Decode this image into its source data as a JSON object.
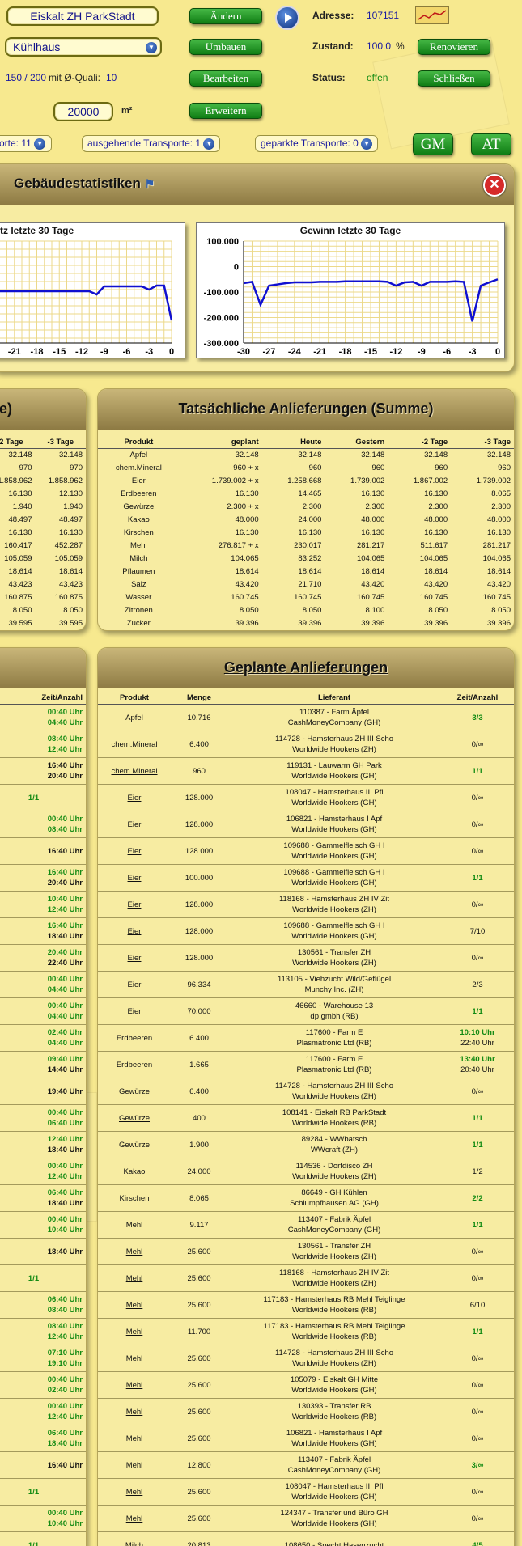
{
  "top": {
    "building_name": "Eiskalt ZH ParkStadt",
    "building_type": "Kühlhaus",
    "quali_prefix": "150 / 200",
    "quali_mid": " mit Ø-Quali:",
    "quali_value": "10",
    "area_value": "20000",
    "area_unit": "m²",
    "btn_aendern": "Ändern",
    "btn_umbauen": "Umbauen",
    "btn_bearbeiten": "Bearbeiten",
    "btn_erweitern": "Erweitern",
    "adresse_label": "Adresse:",
    "adresse_value": "107151",
    "zustand_label": "Zustand:",
    "zustand_value": "100.0",
    "zustand_unit": "%",
    "status_label": "Status:",
    "status_value": "offen",
    "btn_renovieren": "Renovieren",
    "btn_schliessen": "Schließen",
    "filter_left": "orte: 11",
    "filter_out": "ausgehende Transporte: 1",
    "filter_parked": "geparkte Transporte: 0",
    "btn_gm": "GM",
    "btn_at": "AT"
  },
  "stats": {
    "title": "Gebäudestatistiken"
  },
  "chart_data": [
    {
      "type": "line",
      "title": "tz letzte 30 Tage",
      "x": [
        -21,
        -18,
        -15,
        -12,
        -9,
        -6,
        -3,
        0
      ],
      "xlabel": "",
      "ylabel": ""
    },
    {
      "type": "line",
      "title": "Gewinn letzte 30 Tage",
      "x": [
        -30,
        -29,
        -28,
        -27,
        -26,
        -25,
        -24,
        -23,
        -22,
        -21,
        -20,
        -19,
        -18,
        -17,
        -16,
        -15,
        -14,
        -13,
        -12,
        -11,
        -10,
        -9,
        -8,
        -7,
        -6,
        -5,
        -4,
        -3,
        -2,
        -1,
        0
      ],
      "values": [
        -65000,
        -60000,
        -150000,
        -75000,
        -70000,
        -65000,
        -62000,
        -62000,
        -62000,
        -60000,
        -60000,
        -60000,
        -58000,
        -58000,
        -58000,
        -58000,
        -58000,
        -60000,
        -75000,
        -62000,
        -60000,
        -75000,
        -60000,
        -60000,
        -60000,
        -58000,
        -60000,
        -215000,
        -75000,
        -62000,
        -50000
      ],
      "y_ticks": [
        "100.000",
        "0",
        "-100.000",
        "-200.000",
        "-300.000"
      ],
      "x_ticks": [
        "-30",
        "-27",
        "-24",
        "-21",
        "-18",
        "-15",
        "-12",
        "-9",
        "-6",
        "-3",
        "0"
      ],
      "ylim": [
        -300000,
        100000
      ]
    }
  ],
  "left_small": {
    "headers": [
      "-2 Tage",
      "-3 Tage"
    ],
    "rows": [
      [
        "32.148",
        "32.148"
      ],
      [
        "970",
        "970"
      ],
      [
        "1.858.962",
        "1.858.962"
      ],
      [
        "16.130",
        "12.130"
      ],
      [
        "1.940",
        "1.940"
      ],
      [
        "48.497",
        "48.497"
      ],
      [
        "16.130",
        "16.130"
      ],
      [
        "160.417",
        "452.287"
      ],
      [
        "105.059",
        "105.059"
      ],
      [
        "18.614",
        "18.614"
      ],
      [
        "43.423",
        "43.423"
      ],
      [
        "160.875",
        "160.875"
      ],
      [
        "8.050",
        "8.050"
      ],
      [
        "39.595",
        "39.595"
      ]
    ]
  },
  "actual": {
    "title": "Tatsächliche Anlieferungen (Summe)",
    "headers": [
      "Produkt",
      "geplant",
      "Heute",
      "Gestern",
      "-2 Tage",
      "-3 Tage"
    ],
    "rows": [
      [
        "Äpfel",
        "32.148",
        "32.148",
        "32.148",
        "32.148",
        "32.148"
      ],
      [
        "chem.Mineral",
        "960 + x",
        "960",
        "960",
        "960",
        "960"
      ],
      [
        "Eier",
        "1.739.002 + x",
        "1.258.668",
        "1.739.002",
        "1.867.002",
        "1.739.002"
      ],
      [
        "Erdbeeren",
        "16.130",
        "14.465",
        "16.130",
        "16.130",
        "8.065"
      ],
      [
        "Gewürze",
        "2.300 + x",
        "2.300",
        "2.300",
        "2.300",
        "2.300"
      ],
      [
        "Kakao",
        "48.000",
        "24.000",
        "48.000",
        "48.000",
        "48.000"
      ],
      [
        "Kirschen",
        "16.130",
        "16.130",
        "16.130",
        "16.130",
        "16.130"
      ],
      [
        "Mehl",
        "276.817 + x",
        "230.017",
        "281.217",
        "511.617",
        "281.217"
      ],
      [
        "Milch",
        "104.065",
        "83.252",
        "104.065",
        "104.065",
        "104.065"
      ],
      [
        "Pflaumen",
        "18.614",
        "18.614",
        "18.614",
        "18.614",
        "18.614"
      ],
      [
        "Salz",
        "43.420",
        "21.710",
        "43.420",
        "43.420",
        "43.420"
      ],
      [
        "Wasser",
        "160.745",
        "160.745",
        "160.745",
        "160.745",
        "160.745"
      ],
      [
        "Zitronen",
        "8.050",
        "8.050",
        "8.100",
        "8.050",
        "8.050"
      ],
      [
        "Zucker",
        "39.396",
        "39.396",
        "39.396",
        "39.396",
        "39.396"
      ]
    ]
  },
  "left_small2": {
    "header": "Zeit/Anzahl",
    "rows": [
      [
        "00:40 Uhr",
        "04:40 Uhr"
      ],
      [
        "08:40 Uhr",
        "12:40 Uhr"
      ],
      [
        "16:40 Uhr",
        "20:40 Uhr"
      ],
      [
        "1/1",
        ""
      ],
      [
        "00:40 Uhr",
        "08:40 Uhr"
      ],
      [
        "16:40 Uhr",
        ""
      ],
      [
        "16:40 Uhr",
        "20:40 Uhr"
      ],
      [
        "10:40 Uhr",
        "12:40 Uhr"
      ],
      [
        "16:40 Uhr",
        "18:40 Uhr"
      ],
      [
        "20:40 Uhr",
        "22:40 Uhr"
      ],
      [
        "00:40 Uhr",
        "04:40 Uhr"
      ],
      [
        "00:40 Uhr",
        "04:40 Uhr"
      ],
      [
        "02:40 Uhr",
        "04:40 Uhr"
      ],
      [
        "09:40 Uhr",
        "14:40 Uhr"
      ],
      [
        "19:40 Uhr",
        ""
      ],
      [
        "00:40 Uhr",
        "06:40 Uhr"
      ],
      [
        "12:40 Uhr",
        "18:40 Uhr"
      ],
      [
        "00:40 Uhr",
        "12:40 Uhr"
      ],
      [
        "06:40 Uhr",
        "18:40 Uhr"
      ],
      [
        "00:40 Uhr",
        "10:40 Uhr"
      ],
      [
        "18:40 Uhr",
        ""
      ],
      [
        "1/1",
        ""
      ],
      [
        "06:40 Uhr",
        "08:40 Uhr"
      ],
      [
        "08:40 Uhr",
        "12:40 Uhr"
      ],
      [
        "07:10 Uhr",
        "19:10 Uhr"
      ],
      [
        "00:40 Uhr",
        "02:40 Uhr"
      ],
      [
        "00:40 Uhr",
        "12:40 Uhr"
      ],
      [
        "06:40 Uhr",
        "18:40 Uhr"
      ],
      [
        "16:40 Uhr",
        ""
      ],
      [
        "1/1",
        ""
      ],
      [
        "00:40 Uhr",
        "10:40 Uhr"
      ],
      [
        "1/1",
        ""
      ]
    ]
  },
  "planned": {
    "title": "Geplante Anlieferungen",
    "headers": [
      "Produkt",
      "Menge",
      "Lieferant",
      "Zeit/Anzahl"
    ],
    "rows": [
      {
        "p": "Äpfel",
        "u": false,
        "m": "10.716",
        "l1": "110387 - Farm Äpfel",
        "l2": "CashMoneyCompany (GH)",
        "z1": "3/3",
        "z2": "",
        "g": true
      },
      {
        "p": "chem.Mineral",
        "u": true,
        "m": "6.400",
        "l1": "114728 - Hamsterhaus ZH III Scho",
        "l2": "Worldwide Hookers (ZH)",
        "z1": "0/∞",
        "z2": "",
        "g": false
      },
      {
        "p": "chem.Mineral",
        "u": true,
        "m": "960",
        "l1": "119131 - Lauwarm GH Park",
        "l2": "Worldwide Hookers (GH)",
        "z1": "1/1",
        "z2": "",
        "g": true
      },
      {
        "p": "Eier",
        "u": true,
        "m": "128.000",
        "l1": "108047 - Hamsterhaus III Pfl",
        "l2": "Worldwide Hookers (GH)",
        "z1": "0/∞",
        "z2": "",
        "g": false
      },
      {
        "p": "Eier",
        "u": true,
        "m": "128.000",
        "l1": "106821 - Hamsterhaus I Apf",
        "l2": "Worldwide Hookers (GH)",
        "z1": "0/∞",
        "z2": "",
        "g": false
      },
      {
        "p": "Eier",
        "u": true,
        "m": "128.000",
        "l1": "109688 - Gammelfleisch GH I",
        "l2": "Worldwide Hookers (GH)",
        "z1": "0/∞",
        "z2": "",
        "g": false
      },
      {
        "p": "Eier",
        "u": true,
        "m": "100.000",
        "l1": "109688 - Gammelfleisch GH I",
        "l2": "Worldwide Hookers (GH)",
        "z1": "1/1",
        "z2": "",
        "g": true
      },
      {
        "p": "Eier",
        "u": true,
        "m": "128.000",
        "l1": "118168 - Hamsterhaus ZH IV Zit",
        "l2": "Worldwide Hookers (ZH)",
        "z1": "0/∞",
        "z2": "",
        "g": false
      },
      {
        "p": "Eier",
        "u": true,
        "m": "128.000",
        "l1": "109688 - Gammelfleisch GH I",
        "l2": "Worldwide Hookers (GH)",
        "z1": "7/10",
        "z2": "",
        "g": false
      },
      {
        "p": "Eier",
        "u": true,
        "m": "128.000",
        "l1": "130561 - Transfer ZH",
        "l2": "Worldwide Hookers (ZH)",
        "z1": "0/∞",
        "z2": "",
        "g": false
      },
      {
        "p": "Eier",
        "u": false,
        "m": "96.334",
        "l1": "113105 - Viehzucht Wild/Geflügel",
        "l2": "Munchy Inc. (ZH)",
        "z1": "2/3",
        "z2": "",
        "g": false
      },
      {
        "p": "Eier",
        "u": false,
        "m": "70.000",
        "l1": "46660 - Warehouse 13",
        "l2": "dp gmbh (RB)",
        "z1": "1/1",
        "z2": "",
        "g": true
      },
      {
        "p": "Erdbeeren",
        "u": false,
        "m": "6.400",
        "l1": "117600 - Farm E",
        "l2": "Plasmatronic Ltd (RB)",
        "z1": "10:10 Uhr",
        "z2": "22:40 Uhr",
        "g": true
      },
      {
        "p": "Erdbeeren",
        "u": false,
        "m": "1.665",
        "l1": "117600 - Farm E",
        "l2": "Plasmatronic Ltd (RB)",
        "z1": "13:40 Uhr",
        "z2": "20:40 Uhr",
        "g": true
      },
      {
        "p": "Gewürze",
        "u": true,
        "m": "6.400",
        "l1": "114728 - Hamsterhaus ZH III Scho",
        "l2": "Worldwide Hookers (ZH)",
        "z1": "0/∞",
        "z2": "",
        "g": false
      },
      {
        "p": "Gewürze",
        "u": true,
        "m": "400",
        "l1": "108141 - Eiskalt RB ParkStadt",
        "l2": "Worldwide Hookers (RB)",
        "z1": "1/1",
        "z2": "",
        "g": true
      },
      {
        "p": "Gewürze",
        "u": false,
        "m": "1.900",
        "l1": "89284 - WWbatsch",
        "l2": "WWcraft (ZH)",
        "z1": "1/1",
        "z2": "",
        "g": true
      },
      {
        "p": "Kakao",
        "u": true,
        "m": "24.000",
        "l1": "114536 - Dorfdisco ZH",
        "l2": "Worldwide Hookers (ZH)",
        "z1": "1/2",
        "z2": "",
        "g": false
      },
      {
        "p": "Kirschen",
        "u": false,
        "m": "8.065",
        "l1": "86649 - GH Kühlen",
        "l2": "Schlumpfhausen AG (GH)",
        "z1": "2/2",
        "z2": "",
        "g": true
      },
      {
        "p": "Mehl",
        "u": false,
        "m": "9.117",
        "l1": "113407 - Fabrik Äpfel",
        "l2": "CashMoneyCompany (GH)",
        "z1": "1/1",
        "z2": "",
        "g": true
      },
      {
        "p": "Mehl",
        "u": true,
        "m": "25.600",
        "l1": "130561 - Transfer ZH",
        "l2": "Worldwide Hookers (ZH)",
        "z1": "0/∞",
        "z2": "",
        "g": false
      },
      {
        "p": "Mehl",
        "u": true,
        "m": "25.600",
        "l1": "118168 - Hamsterhaus ZH IV Zit",
        "l2": "Worldwide Hookers (ZH)",
        "z1": "0/∞",
        "z2": "",
        "g": false
      },
      {
        "p": "Mehl",
        "u": true,
        "m": "25.600",
        "l1": "117183 - Hamsterhaus RB Mehl Teiglinge",
        "l2": "Worldwide Hookers (RB)",
        "z1": "6/10",
        "z2": "",
        "g": false
      },
      {
        "p": "Mehl",
        "u": true,
        "m": "11.700",
        "l1": "117183 - Hamsterhaus RB Mehl Teiglinge",
        "l2": "Worldwide Hookers (RB)",
        "z1": "1/1",
        "z2": "",
        "g": true
      },
      {
        "p": "Mehl",
        "u": true,
        "m": "25.600",
        "l1": "114728 - Hamsterhaus ZH III Scho",
        "l2": "Worldwide Hookers (ZH)",
        "z1": "0/∞",
        "z2": "",
        "g": false
      },
      {
        "p": "Mehl",
        "u": true,
        "m": "25.600",
        "l1": "105079 - Eiskalt GH Mitte",
        "l2": "Worldwide Hookers (GH)",
        "z1": "0/∞",
        "z2": "",
        "g": false
      },
      {
        "p": "Mehl",
        "u": true,
        "m": "25.600",
        "l1": "130393 - Transfer RB",
        "l2": "Worldwide Hookers (RB)",
        "z1": "0/∞",
        "z2": "",
        "g": false
      },
      {
        "p": "Mehl",
        "u": true,
        "m": "25.600",
        "l1": "106821 - Hamsterhaus I Apf",
        "l2": "Worldwide Hookers (GH)",
        "z1": "0/∞",
        "z2": "",
        "g": false
      },
      {
        "p": "Mehl",
        "u": false,
        "m": "12.800",
        "l1": "113407 - Fabrik Äpfel",
        "l2": "CashMoneyCompany (GH)",
        "z1": "3/∞",
        "z2": "",
        "g": true
      },
      {
        "p": "Mehl",
        "u": true,
        "m": "25.600",
        "l1": "108047 - Hamsterhaus III Pfl",
        "l2": "Worldwide Hookers (GH)",
        "z1": "0/∞",
        "z2": "",
        "g": false
      },
      {
        "p": "Mehl",
        "u": true,
        "m": "25.600",
        "l1": "124347 - Transfer und Büro GH",
        "l2": "Worldwide Hookers (GH)",
        "z1": "0/∞",
        "z2": "",
        "g": false
      },
      {
        "p": "Milch",
        "u": false,
        "m": "20.813",
        "l1": "108650 - Specht Hasenzucht",
        "l2": "",
        "z1": "4/5",
        "z2": "",
        "g": true
      }
    ]
  }
}
